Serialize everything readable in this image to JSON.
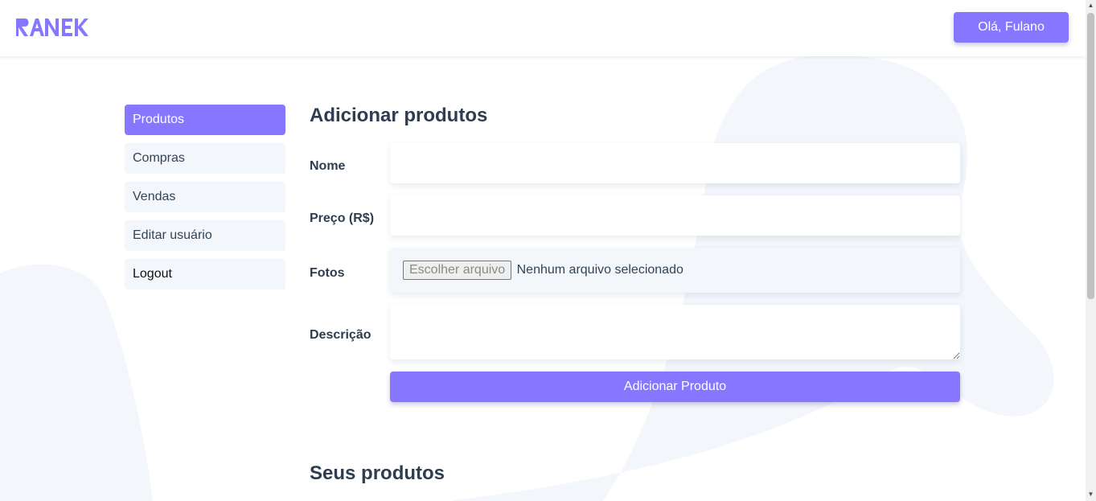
{
  "header": {
    "logo_text": "RANEK",
    "user_button": "Olá, Fulano"
  },
  "sidebar": {
    "items": [
      {
        "label": "Produtos",
        "active": true
      },
      {
        "label": "Compras"
      },
      {
        "label": "Vendas"
      },
      {
        "label": "Editar usuário"
      },
      {
        "label": "Logout"
      }
    ]
  },
  "form": {
    "title": "Adicionar produtos",
    "nome_label": "Nome",
    "nome_value": "",
    "preco_label": "Preço (R$)",
    "preco_value": "",
    "fotos_label": "Fotos",
    "file_button": "Escolher arquivo",
    "file_status": "Nenhum arquivo selecionado",
    "descricao_label": "Descrição",
    "descricao_value": "",
    "submit_label": "Adicionar Produto"
  },
  "products": {
    "title": "Seus produtos"
  },
  "colors": {
    "accent": "#8577ff",
    "light_bg": "#f3f6fb",
    "text": "#334455"
  }
}
